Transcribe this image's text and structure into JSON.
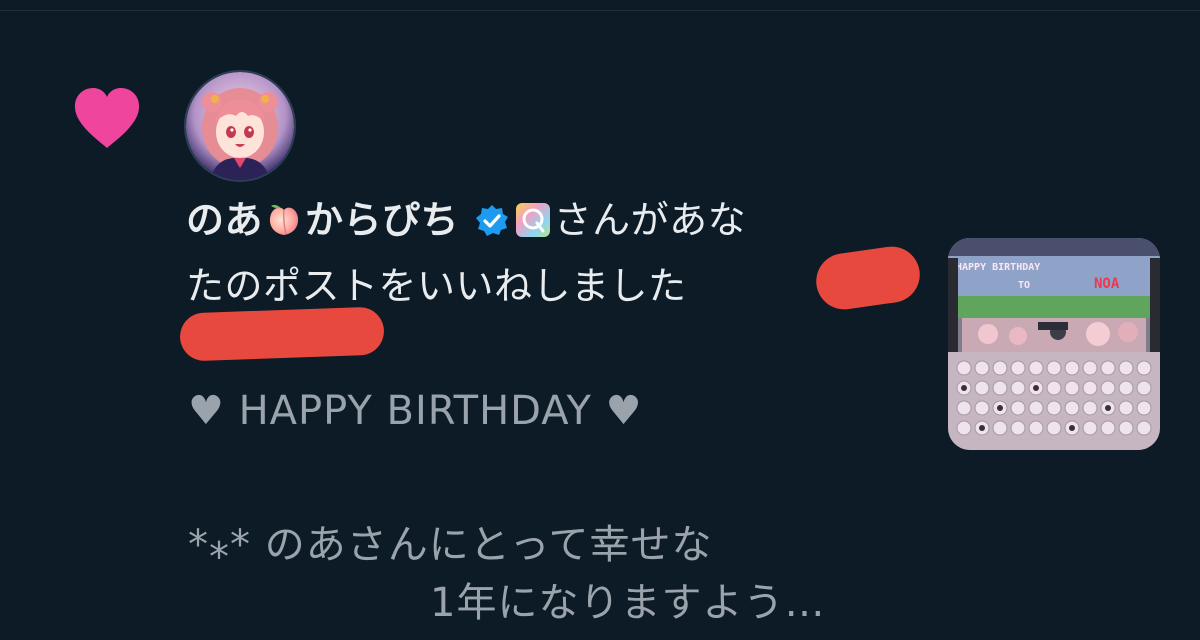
{
  "notification": {
    "icon": "heart-icon",
    "accent_color": "#f0459d",
    "user_name": "のあ",
    "user_name_suffix": "からぴち",
    "name_emoji": "peach",
    "verified_icon": "verified-badge-icon",
    "affiliate_badge": "affiliate-badge-icon",
    "message_part1": "さんがあな",
    "message_part2": "たのポストをいいねしました"
  },
  "post": {
    "line1": "♥ HAPPY BIRTHDAY ♥",
    "line2": "*⁎* のあさんにとって幸せな",
    "line3": "1年になりますよう…"
  },
  "thumbnail": {
    "banner_text_1": "HAPPY BIRTHDAY",
    "banner_text_2": "TO",
    "banner_text_3": "NOA"
  }
}
